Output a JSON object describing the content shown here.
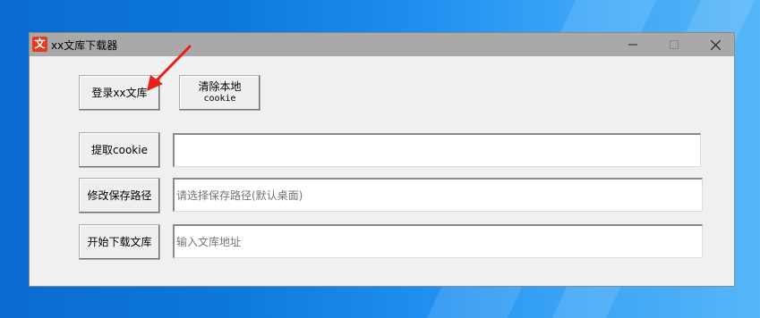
{
  "window": {
    "app_icon_glyph": "文",
    "title": "xx文库下载器"
  },
  "buttons": {
    "login": "登录xx文库",
    "clear_line1": "清除本地",
    "clear_line2": "cookie",
    "extract_cookie": "提取cookie",
    "change_path": "修改保存路径",
    "start_download": "开始下载文库"
  },
  "fields": {
    "cookie_value": "",
    "save_path_placeholder": "请选择保存路径(默认桌面)",
    "url_placeholder": "输入文库地址"
  },
  "icons": {
    "minimize": "minimize-icon",
    "maximize": "maximize-icon",
    "close": "close-icon",
    "annotation": "red-arrow-icon"
  },
  "colors": {
    "titlebar": "#a9a9a9",
    "window_bg": "#f0f0f0",
    "app_icon": "#e33b1e",
    "arrow": "#e8201a"
  }
}
